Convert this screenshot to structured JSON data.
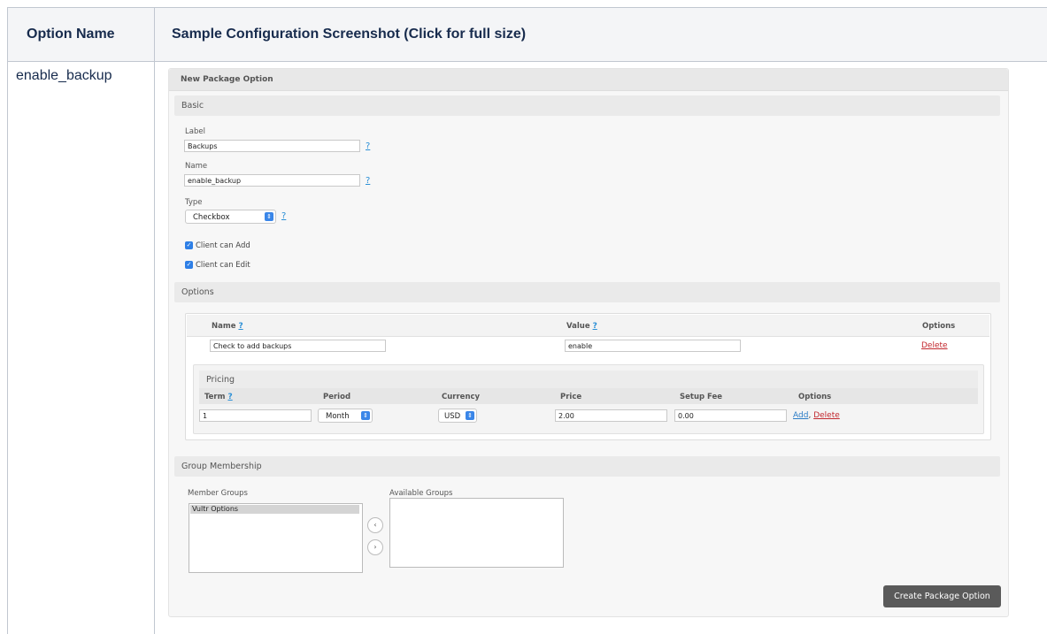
{
  "table": {
    "headers": [
      "Option Name",
      "Sample Configuration Screenshot (Click for full size)"
    ],
    "row_label": "enable_backup"
  },
  "panel": {
    "title": "New Package Option",
    "basic": {
      "title": "Basic",
      "label_caption": "Label",
      "label_value": "Backups",
      "name_caption": "Name",
      "name_value": "enable_backup",
      "type_caption": "Type",
      "type_value": "Checkbox",
      "help": "?",
      "client_can_add": "Client can Add",
      "client_can_edit": "Client can Edit"
    },
    "options": {
      "title": "Options",
      "col_name": "Name",
      "col_value": "Value",
      "col_options": "Options",
      "row_name": "Check to add backups",
      "row_value": "enable",
      "delete": "Delete"
    },
    "pricing": {
      "title": "Pricing",
      "cols": [
        "Term",
        "Period",
        "Currency",
        "Price",
        "Setup Fee",
        "Options"
      ],
      "term": "1",
      "period": "Month",
      "currency": "USD",
      "price": "2.00",
      "setup_fee": "0.00",
      "add": "Add",
      "sep": ",",
      "delete": "Delete"
    },
    "groups": {
      "title": "Group Membership",
      "member_caption": "Member Groups",
      "available_caption": "Available Groups",
      "member_items": [
        "Vultr Options"
      ],
      "move_left": "‹",
      "move_right": "›"
    },
    "submit": "Create Package Option"
  }
}
